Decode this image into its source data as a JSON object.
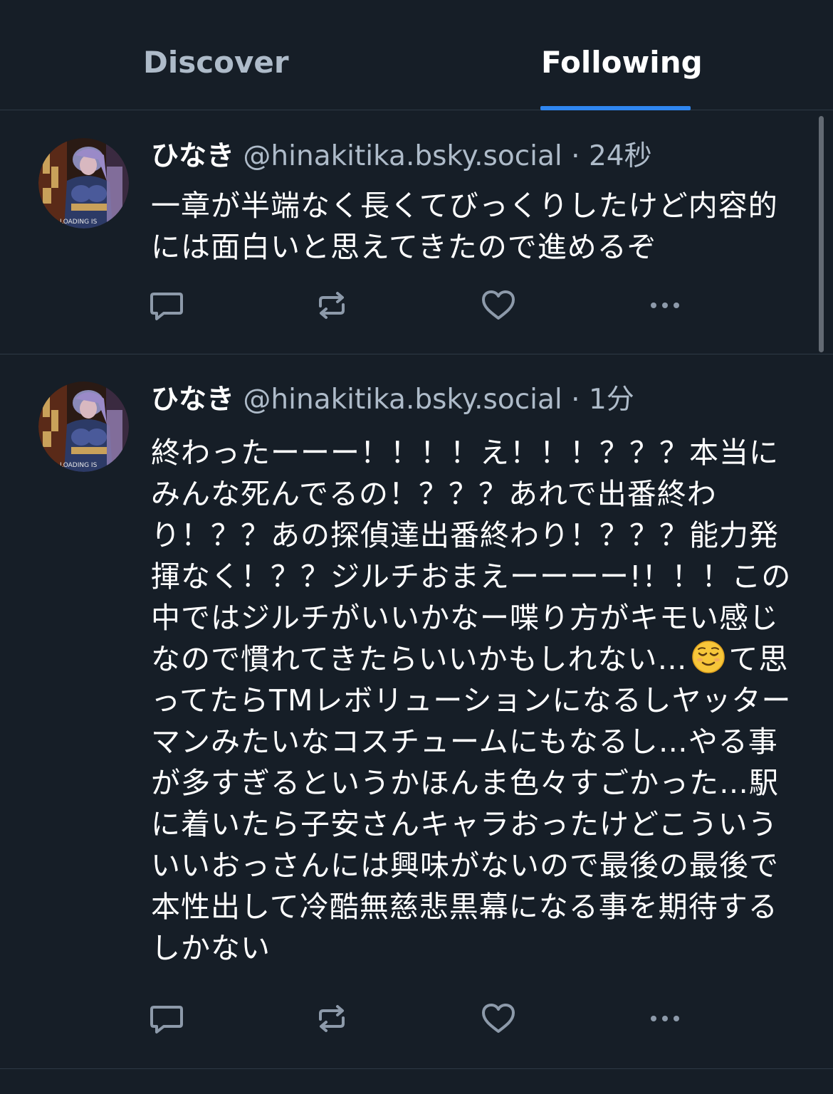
{
  "tabs": {
    "discover": "Discover",
    "following": "Following",
    "active": "following"
  },
  "colors": {
    "background": "#161e27",
    "accent": "#2f86f0",
    "muted_text": "#aebbc9",
    "divider": "#2e3945"
  },
  "posts": [
    {
      "display_name": "ひなき",
      "handle": "@hinakitika.bsky.social",
      "separator": "·",
      "time": "24秒",
      "text": "一章が半端なく長くてびっくりしたけど内容的には面白いと思えてきたので進めるぞ",
      "avatar_text": "LOADING IS",
      "actions": [
        "reply-icon",
        "repost-icon",
        "like-icon",
        "more-icon"
      ]
    },
    {
      "display_name": "ひなき",
      "handle": "@hinakitika.bsky.social",
      "separator": "·",
      "time": "1分",
      "text_before_emoji": "終わったーーー！！！！え！！！？？？本当にみんな死んでるの！？？？あれで出番終わり！？？あの探偵達出番終わり！？？？能力発揮なく！？？ジルチおまえーーーー!！！！この中ではジルチがいいかなー喋り方がキモい感じなので慣れてきたらいいかもしれない…",
      "emoji": "relieved-face-emoji",
      "text_after_emoji": "て思ってたらTMレボリューションになるしヤッターマンみたいなコスチュームにもなるし…やる事が多すぎるというかほんま色々すごかった…駅に着いたら子安さんキャラおったけどこういういいおっさんには興味がないので最後の最後で本性出して冷酷無慈悲黒幕になる事を期待するしかない",
      "avatar_text": "LOADING IS",
      "actions": [
        "reply-icon",
        "repost-icon",
        "like-icon",
        "more-icon"
      ]
    }
  ]
}
